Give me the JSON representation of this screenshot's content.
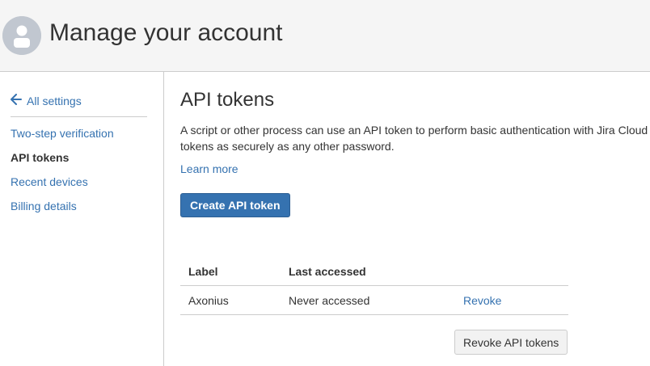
{
  "header": {
    "title": "Manage your account",
    "avatar_icon": "user-avatar-icon"
  },
  "sidebar": {
    "back_label": "All settings",
    "back_icon": "arrow-left-icon",
    "items": [
      {
        "label": "Two-step verification",
        "active": false
      },
      {
        "label": "API tokens",
        "active": true
      },
      {
        "label": "Recent devices",
        "active": false
      },
      {
        "label": "Billing details",
        "active": false
      }
    ]
  },
  "main": {
    "title": "API tokens",
    "description": "A script or other process can use an API token to perform basic authentication with Jira Cloud tokens as securely as any other password.",
    "learn_more": "Learn more",
    "create_button": "Create API token",
    "table": {
      "headers": [
        "Label",
        "Last accessed",
        ""
      ],
      "rows": [
        {
          "label": "Axonius",
          "last_accessed": "Never accessed",
          "action": "Revoke"
        }
      ]
    },
    "revoke_all_button": "Revoke API tokens"
  },
  "colors": {
    "link": "#3572b0",
    "primary_button": "#3572b0",
    "header_bg": "#f5f5f5",
    "border": "#cccccc"
  }
}
